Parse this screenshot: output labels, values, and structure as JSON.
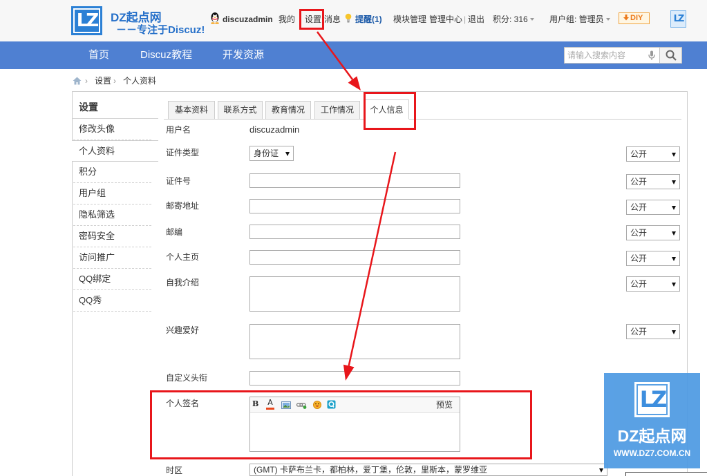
{
  "header": {
    "logo_mark": "LZ",
    "logo_title": "DZ起点网",
    "logo_tagline": "－－专注于Discuz!",
    "username": "discuzadmin",
    "my": "我的",
    "settings": "设置",
    "messages": "消息",
    "reminder": "提醒(1)",
    "module_admin": "模块管理",
    "admin_center": "管理中心",
    "separator": "|",
    "logout": "退出",
    "credits": "积分: 316",
    "usergroup": "用户组: 管理员",
    "diy": "DIY",
    "right_mark": "LZ",
    "icons": [
      "qq-icon",
      "bulb-icon",
      "chevron-down-icon",
      "diy-arrow-icon"
    ]
  },
  "nav": {
    "items": [
      "首页",
      "Discuz教程",
      "开发资源"
    ],
    "search_placeholder": "请输入搜索内容",
    "icons": [
      "mic-icon",
      "search-icon"
    ]
  },
  "breadcrumb": {
    "icon": "home-icon",
    "items": [
      "设置",
      "个人资料"
    ]
  },
  "sidebar": {
    "title": "设置",
    "items": [
      {
        "label": "修改头像",
        "active": false
      },
      {
        "label": "个人资料",
        "active": true
      },
      {
        "label": "积分",
        "active": false
      },
      {
        "label": "用户组",
        "active": false
      },
      {
        "label": "隐私筛选",
        "active": false
      },
      {
        "label": "密码安全",
        "active": false
      },
      {
        "label": "访问推广",
        "active": false
      },
      {
        "label": "QQ绑定",
        "active": false
      },
      {
        "label": "QQ秀",
        "active": false
      }
    ]
  },
  "tabs": [
    {
      "label": "基本资料",
      "active": false
    },
    {
      "label": "联系方式",
      "active": false
    },
    {
      "label": "教育情况",
      "active": false
    },
    {
      "label": "工作情况",
      "active": false
    },
    {
      "label": "个人信息",
      "active": true
    }
  ],
  "form": {
    "username": {
      "label": "用户名",
      "value": "discuzadmin"
    },
    "id_type": {
      "label": "证件类型",
      "value": "身份证",
      "privacy": "公开"
    },
    "id_number": {
      "label": "证件号",
      "value": "",
      "privacy": "公开"
    },
    "address": {
      "label": "邮寄地址",
      "value": "",
      "privacy": "公开"
    },
    "zipcode": {
      "label": "邮编",
      "value": "",
      "privacy": "公开"
    },
    "homepage": {
      "label": "个人主页",
      "value": "",
      "privacy": "公开"
    },
    "bio": {
      "label": "自我介绍",
      "value": "",
      "privacy": "公开"
    },
    "interest": {
      "label": "兴趣爱好",
      "value": "",
      "privacy": "公开"
    },
    "custom_title": {
      "label": "自定义头衔",
      "value": ""
    },
    "signature": {
      "label": "个人签名",
      "value": "",
      "toolbar": {
        "bold": "B",
        "font_color": "A",
        "icons": [
          "image-icon",
          "link-icon",
          "smiley-icon",
          "qq-show-icon"
        ]
      },
      "preview": "预览"
    },
    "timezone": {
      "label": "时区",
      "value": "(GMT) 卡萨布兰卡，都柏林，爱丁堡，伦敦，里斯本，蒙罗维亚"
    }
  },
  "watermark": {
    "mark": "LZ",
    "title": "DZ起点网",
    "url": "WWW.DZ7.COM.CN"
  },
  "colors": {
    "nav_bg": "#4f80d2",
    "brand_blue": "#2b80d5",
    "annotation_red": "#e8161b",
    "reminder_blue": "#1c5aa8",
    "diy_orange": "#ec7a1c",
    "watermark_bg": "#4e9ae3"
  }
}
